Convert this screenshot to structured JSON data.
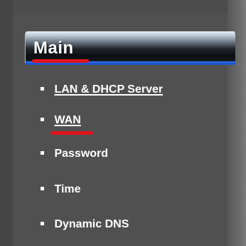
{
  "sidebar": {
    "section_title": "Main",
    "items": [
      {
        "label": "LAN & DHCP Server"
      },
      {
        "label": "WAN"
      },
      {
        "label": "Password"
      },
      {
        "label": "Time"
      },
      {
        "label": "Dynamic DNS"
      }
    ]
  },
  "colors": {
    "background": "#505050",
    "header_accent": "#1f56c9",
    "annotation": "#e0141b",
    "text": "#ffffff"
  }
}
